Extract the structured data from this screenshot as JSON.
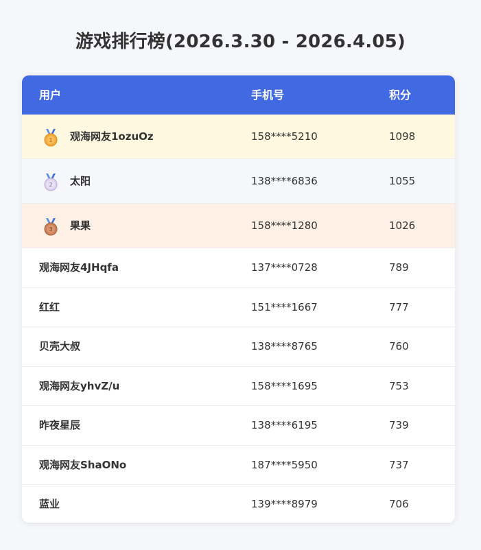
{
  "page": {
    "title": "游戏排行榜(2026.3.30 - 2026.4.05)"
  },
  "columns": {
    "user": "用户",
    "phone": "手机号",
    "score": "积分"
  },
  "colors": {
    "header_bg": "#4169e1",
    "gold_row": "#fff8e1",
    "silver_row": "#f5f7fa",
    "bronze_row": "#fff0e6"
  },
  "rows": [
    {
      "rank": "1",
      "name": "观海网友1ozuOz",
      "phone": "158****5210",
      "score": "1098",
      "medal": "gold-medal-icon"
    },
    {
      "rank": "2",
      "name": "太阳",
      "phone": "138****6836",
      "score": "1055",
      "medal": "silver-medal-icon"
    },
    {
      "rank": "3",
      "name": "果果",
      "phone": "158****1280",
      "score": "1026",
      "medal": "bronze-medal-icon"
    },
    {
      "name": "观海网友4JHqfa",
      "phone": "137****0728",
      "score": "789"
    },
    {
      "name": "红红",
      "phone": "151****1667",
      "score": "777"
    },
    {
      "name": "贝壳大叔",
      "phone": "138****8765",
      "score": "760"
    },
    {
      "name": "观海网友yhvZ/u",
      "phone": "158****1695",
      "score": "753"
    },
    {
      "name": "昨夜星辰",
      "phone": "138****6195",
      "score": "739"
    },
    {
      "name": "观海网友ShaONo",
      "phone": "187****5950",
      "score": "737"
    },
    {
      "name": "蓝业",
      "phone": "139****8979",
      "score": "706"
    }
  ]
}
